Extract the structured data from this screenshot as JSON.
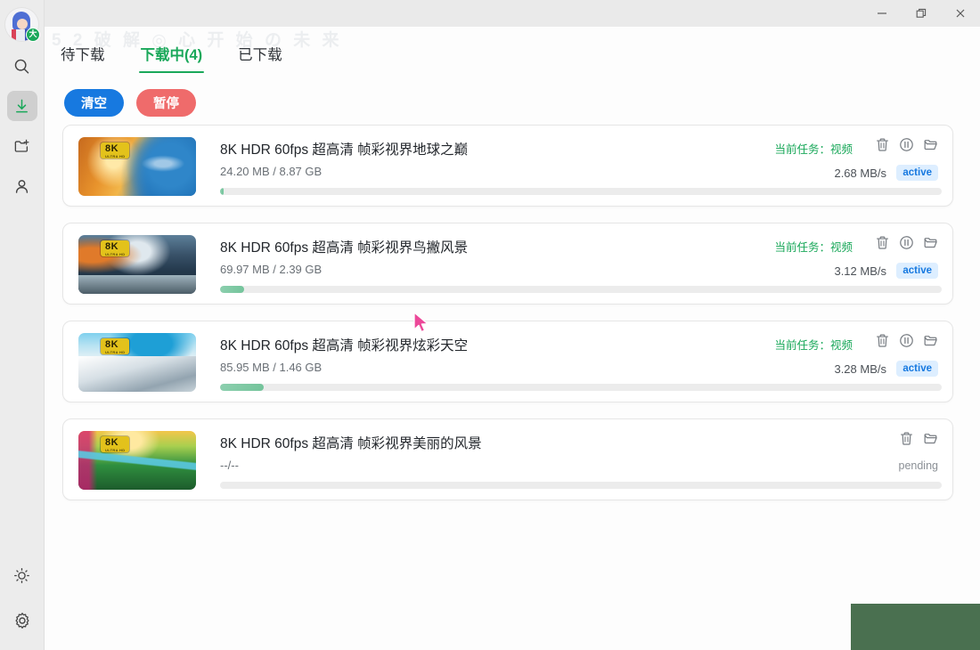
{
  "window": {
    "controls": [
      {
        "name": "minimize",
        "glyph": "minimize-icon"
      },
      {
        "name": "restore",
        "glyph": "restore-icon"
      },
      {
        "name": "close",
        "glyph": "close-icon"
      }
    ]
  },
  "watermark": {
    "text": "5 2 破 解 ◎ 心 开 始 の 未 来",
    "repeat_text": "5 2 破 解 ◎ 心 开 始 の 未 来"
  },
  "sidebar": {
    "avatar": {
      "name": "user-avatar",
      "badge": "大"
    },
    "items": [
      {
        "name": "sidebar-item-search",
        "icon": "search-icon",
        "active": false
      },
      {
        "name": "sidebar-item-downloads",
        "icon": "download-icon",
        "active": true
      },
      {
        "name": "sidebar-item-new-task",
        "icon": "add-folder-icon",
        "active": false
      },
      {
        "name": "sidebar-item-account",
        "icon": "person-icon",
        "active": false
      }
    ],
    "bottom_items": [
      {
        "name": "sidebar-item-theme",
        "icon": "brightness-icon"
      },
      {
        "name": "sidebar-item-settings",
        "icon": "gear-icon"
      }
    ]
  },
  "tabs": [
    {
      "label": "待下载",
      "active": false
    },
    {
      "label": "下载中(4)",
      "active": true
    },
    {
      "label": "已下载",
      "active": false
    }
  ],
  "toolbar": {
    "clear_label": "清空",
    "pause_label": "暂停",
    "clear_color": "#1779e0",
    "pause_color": "#ef6b6b"
  },
  "colors": {
    "accent_green": "#1aa85a",
    "progress_fill": "#74c49b",
    "badge_active_bg": "#ddeeff",
    "badge_active_text": "#1779e0",
    "overlay_green": "#4a7050"
  },
  "downloads": [
    {
      "title": "8K HDR 60fps 超高清 帧彩视界地球之巅",
      "size": "24.20 MB / 8.87 GB",
      "progress": 0.45,
      "task_label": "当前任务：视频",
      "speed": "2.68 MB/s",
      "status": "active",
      "status_type": "badge",
      "thumb_badge": "8K",
      "thumb_badge_sub": "ULTRA HD",
      "has_pause": true
    },
    {
      "title": "8K HDR 60fps 超高清 帧彩视界鸟撇风景",
      "size": "69.97 MB / 2.39 GB",
      "progress": 3.3,
      "task_label": "当前任务：视频",
      "speed": "3.12 MB/s",
      "status": "active",
      "status_type": "badge",
      "thumb_badge": "8K",
      "thumb_badge_sub": "ULTRA HD",
      "has_pause": true
    },
    {
      "title": "8K HDR 60fps 超高清 帧彩视界炫彩天空",
      "size": "85.95 MB / 1.46 GB",
      "progress": 6.1,
      "task_label": "当前任务：视频",
      "speed": "3.28 MB/s",
      "status": "active",
      "status_type": "badge",
      "thumb_badge": "8K",
      "thumb_badge_sub": "ULTRA HD",
      "has_pause": true
    },
    {
      "title": "8K HDR 60fps 超高清 帧彩视界美丽的风景",
      "size": "--/--",
      "progress": 0,
      "task_label": "",
      "speed": "",
      "status": "pending",
      "status_type": "text",
      "thumb_badge": "8K",
      "thumb_badge_sub": "ULTRA HD",
      "has_pause": false
    }
  ]
}
